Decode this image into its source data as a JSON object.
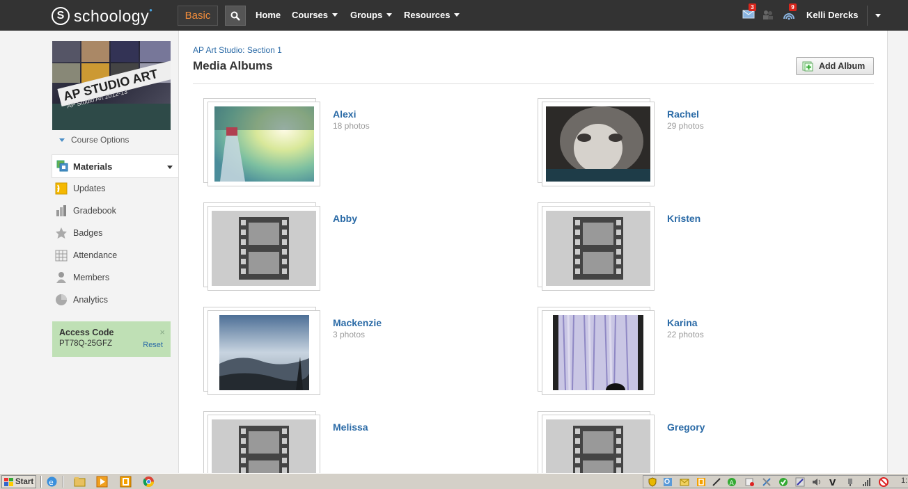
{
  "topbar": {
    "logo_text": "schoology",
    "logo_letter": "S",
    "plan_badge": "Basic",
    "nav": [
      {
        "label": "Home"
      },
      {
        "label": "Courses"
      },
      {
        "label": "Groups"
      },
      {
        "label": "Resources"
      }
    ],
    "messages_count": "3",
    "notifications_count": "9",
    "user_name": "Kelli Dercks"
  },
  "sidebar": {
    "course_image_banner": "AP STUDIO ART",
    "course_image_sub": "AP Studio Art 2012-13",
    "course_options": "Course Options",
    "active_item": "Materials",
    "items": [
      {
        "label": "Updates"
      },
      {
        "label": "Gradebook"
      },
      {
        "label": "Badges"
      },
      {
        "label": "Attendance"
      },
      {
        "label": "Members"
      },
      {
        "label": "Analytics"
      }
    ],
    "access_code": {
      "title": "Access Code",
      "code": "PT78Q-25GFZ",
      "reset": "Reset",
      "close": "×"
    }
  },
  "main": {
    "breadcrumb": "AP Art Studio: Section 1",
    "title": "Media Albums",
    "add_album": "Add Album",
    "albums": [
      {
        "name": "Alexi",
        "count": "18 photos",
        "thumb": "bottle"
      },
      {
        "name": "Rachel",
        "count": "29 photos",
        "thumb": "cat"
      },
      {
        "name": "Abby",
        "count": "",
        "thumb": "placeholder"
      },
      {
        "name": "Kristen",
        "count": "",
        "thumb": "placeholder"
      },
      {
        "name": "Mackenzie",
        "count": "3 photos",
        "thumb": "mountain"
      },
      {
        "name": "Karina",
        "count": "22 photos",
        "thumb": "paint"
      },
      {
        "name": "Melissa",
        "count": "",
        "thumb": "placeholder"
      },
      {
        "name": "Gregory",
        "count": "",
        "thumb": "placeholder"
      }
    ]
  },
  "taskbar": {
    "start": "Start",
    "clock": "1:"
  },
  "colors": {
    "topbar": "#333333",
    "link": "#2a6aa6",
    "basic_badge": "#f28c3a",
    "access_bg": "#bfe0b5",
    "notif": "#d9261c"
  }
}
